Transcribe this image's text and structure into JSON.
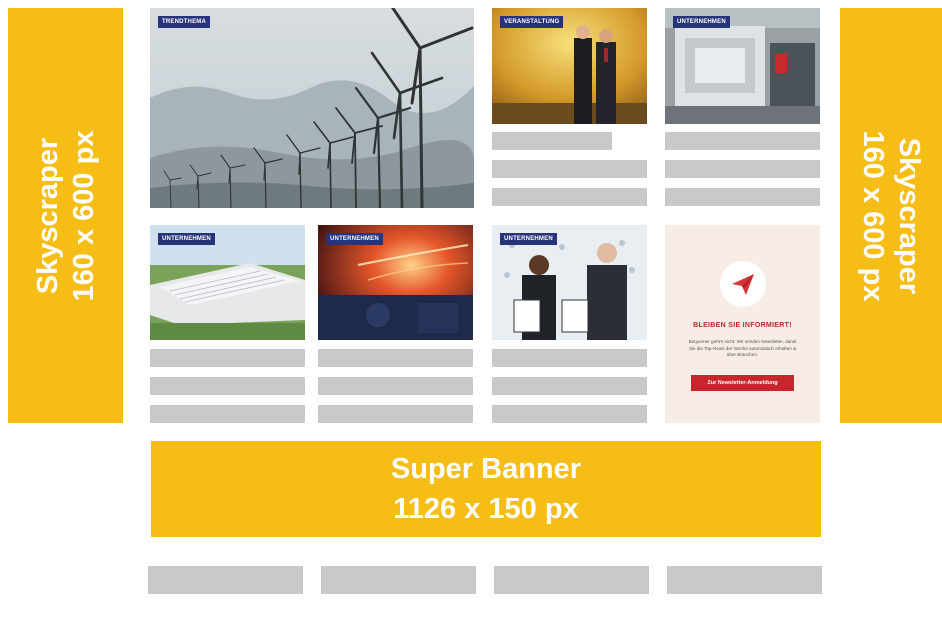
{
  "sky_left": {
    "line1": "Skyscraper",
    "line2": "160 x 600 px"
  },
  "sky_right": {
    "line1": "Skyscraper",
    "line2": "160 x 600 px"
  },
  "super_banner": {
    "line1": "Super Banner",
    "line2": "1126 x 150 px"
  },
  "tiles": {
    "wind": "TRENDTHEMA",
    "event": "VERANSTALTUNG",
    "machine": "UNTERNEHMEN",
    "factory": "UNTERNEHMEN",
    "steel": "UNTERNEHMEN",
    "award": "UNTERNEHMEN"
  },
  "newsletter": {
    "title": "BLEIBEN SIE INFORMIERT!",
    "text": "Bequemer geht's nicht: Wir senden Newsletter, damit Sie die Top-News der Woche automatisch erhalten & über Branchen.",
    "button": "Zur Newsletter-Anmeldung",
    "icon": "paper-plane-icon"
  },
  "colors": {
    "ad_yellow": "#f6bd16",
    "placeholder_grey": "#c9c9c9",
    "tag_navy": "#27347a",
    "newsletter_red": "#c8252d",
    "newsletter_bg": "#f8ece6"
  }
}
